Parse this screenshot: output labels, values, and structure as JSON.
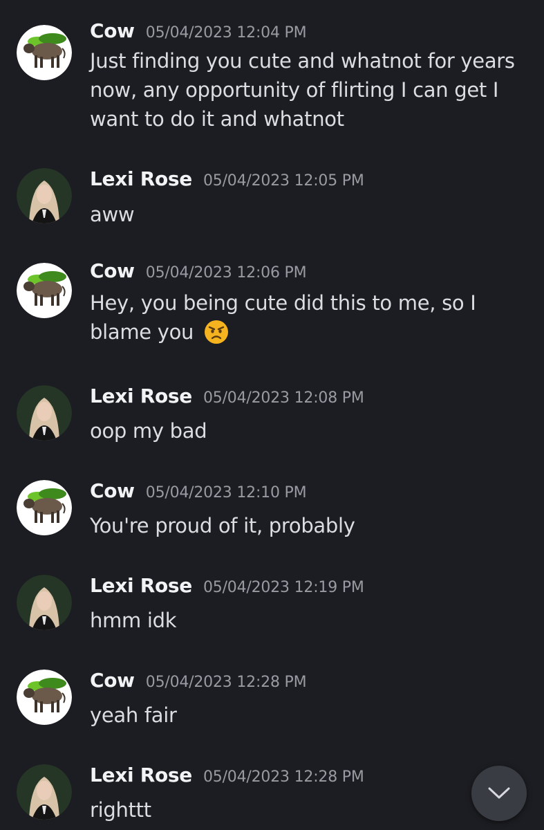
{
  "messages": [
    {
      "author": "Cow",
      "timestamp": "05/04/2023 12:04 PM",
      "text": "Just finding you cute and whatnot for years now, any opportunity of flirting I can get I want to do it and whatnot"
    },
    {
      "author": "Lexi Rose",
      "timestamp": "05/04/2023 12:05 PM",
      "text": "aww"
    },
    {
      "author": "Cow",
      "timestamp": "05/04/2023 12:06 PM",
      "text": "Hey, you being cute did this to me, so I blame you",
      "emoji": "angry-face-emoji"
    },
    {
      "author": "Lexi Rose",
      "timestamp": "05/04/2023 12:08 PM",
      "text": "oop my bad"
    },
    {
      "author": "Cow",
      "timestamp": "05/04/2023 12:10 PM",
      "text": "You're proud of it, probably"
    },
    {
      "author": "Lexi Rose",
      "timestamp": "05/04/2023 12:19 PM",
      "text": "hmm idk"
    },
    {
      "author": "Cow",
      "timestamp": "05/04/2023 12:28 PM",
      "text": "yeah fair"
    },
    {
      "author": "Lexi Rose",
      "timestamp": "05/04/2023 12:28 PM",
      "text": "righttt"
    }
  ],
  "scroll_button": {
    "icon": "chevron-down-icon"
  },
  "colors": {
    "background": "#1c1d22",
    "username": "#f2f3f5",
    "timestamp": "#9a9ba2",
    "message_text": "#dcdde1",
    "scroll_button_bg": "#3a3c43"
  }
}
